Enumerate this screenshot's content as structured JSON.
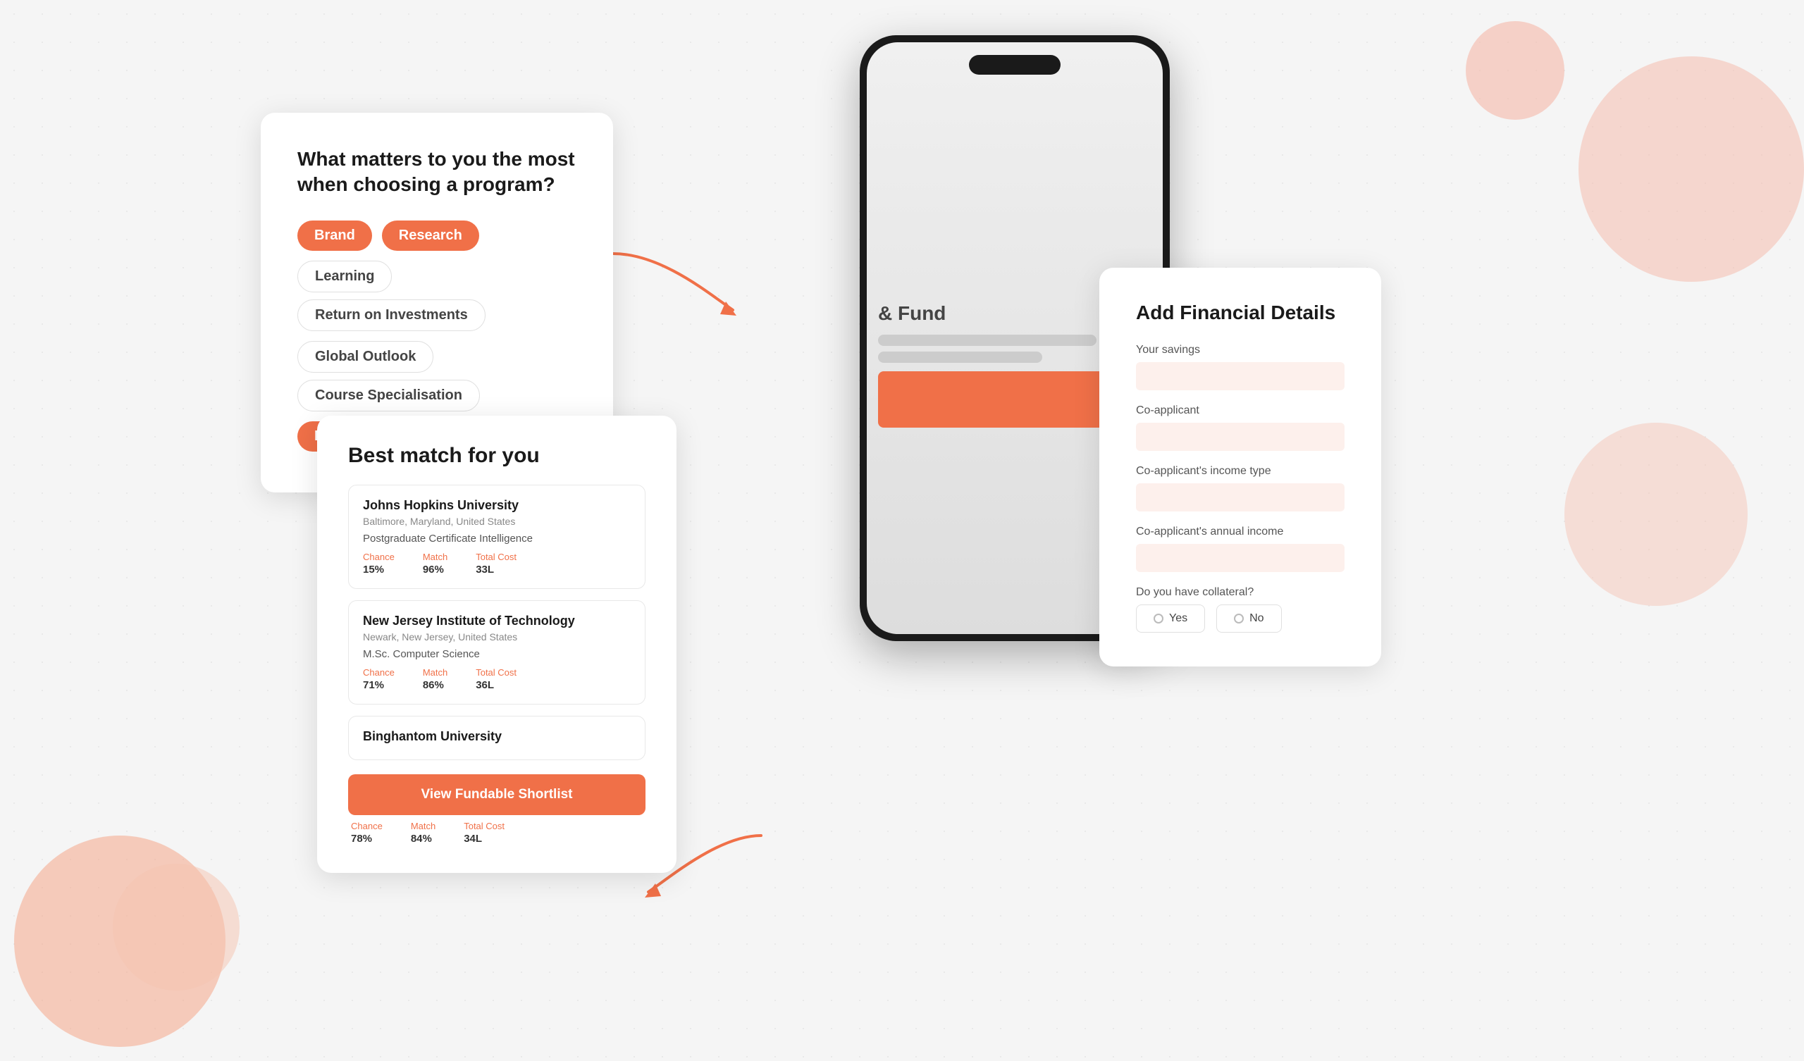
{
  "background": {
    "color": "#f5f5f5"
  },
  "phone": {
    "blurred_text": "& Fund",
    "blurred_bar1_width": "80%",
    "blurred_bar2_width": "60%"
  },
  "card_question": {
    "title": "What matters to you the most when choosing a program?",
    "tags": [
      {
        "label": "Brand",
        "active": true
      },
      {
        "label": "Research",
        "active": true
      },
      {
        "label": "Learning",
        "active": false
      },
      {
        "label": "Return on Investments",
        "active": false
      },
      {
        "label": "Global  Outlook",
        "active": false
      },
      {
        "label": "Course Specialisation",
        "active": false
      },
      {
        "label": "Placemenets",
        "active": true
      }
    ]
  },
  "card_match": {
    "title": "Best match for you",
    "universities": [
      {
        "name": "Johns Hopkins University",
        "location": "Baltimore, Maryland, United States",
        "program": "Postgraduate Certificate Intelligence",
        "chance_label": "Chance",
        "chance_value": "15%",
        "match_label": "Match",
        "match_value": "96%",
        "cost_label": "Total Cost",
        "cost_value": "33L"
      },
      {
        "name": "New Jersey Institute of Technology",
        "location": "Newark, New Jersey, United States",
        "program": "M.Sc. Computer Science",
        "chance_label": "Chance",
        "chance_value": "71%",
        "match_label": "Match",
        "match_value": "86%",
        "cost_label": "Total Cost",
        "cost_value": "36L"
      },
      {
        "name": "Binghantom University",
        "location": "",
        "program": "",
        "chance_label": "Chance",
        "chance_value": "78%",
        "match_label": "Match",
        "match_value": "84%",
        "cost_label": "Total Cost",
        "cost_value": "34L"
      }
    ],
    "cta_label": "View Fundable Shortlist"
  },
  "card_financial": {
    "title": "Add Financial Details",
    "fields": [
      {
        "label": "Your savings",
        "placeholder": ""
      },
      {
        "label": "Co-applicant",
        "placeholder": ""
      },
      {
        "label": "Co-applicant's income type",
        "placeholder": ""
      },
      {
        "label": "Co-applicant's annual income",
        "placeholder": ""
      }
    ],
    "collateral_label": "Do you have collateral?",
    "yes_label": "Yes",
    "no_label": "No"
  },
  "colors": {
    "orange": "#f07048",
    "light_orange_bg": "#fdf0ec",
    "border": "#e0e0e0",
    "text_dark": "#1a1a1a",
    "text_mid": "#555",
    "text_light": "#888"
  }
}
